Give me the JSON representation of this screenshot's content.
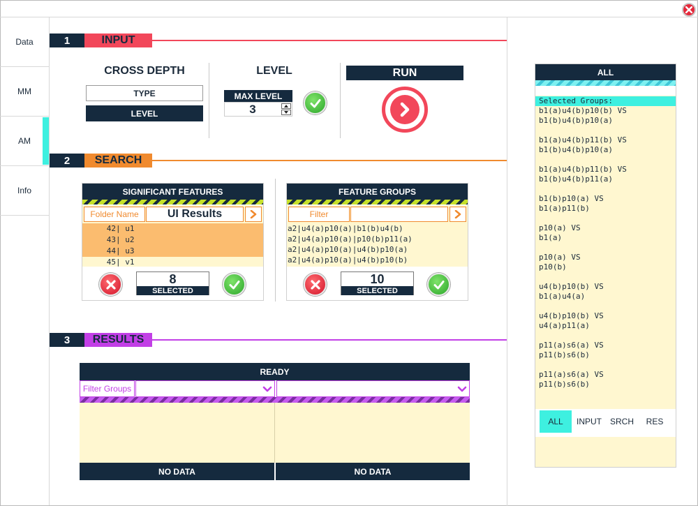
{
  "colors": {
    "navy": "#152a3e",
    "input_accent": "#f2475a",
    "search_accent": "#f08a2e",
    "results_accent": "#c23fe6",
    "cream": "#fff7d0",
    "cyan": "#3ef0e0",
    "green_ok": "#3fc43b",
    "red_cancel": "#e5283a"
  },
  "icons": {
    "close": "close-icon",
    "check": "check-icon",
    "cancel": "x-icon",
    "run": "chevron-right-icon",
    "arrow": "chevron-right-icon",
    "dropdown": "chevron-down-icon"
  },
  "sidebar": {
    "tabs": [
      "Data",
      "MM",
      "AM",
      "Info"
    ],
    "active": "AM"
  },
  "input": {
    "num": "1",
    "title": "INPUT",
    "cross_depth_title": "CROSS DEPTH",
    "type_label": "TYPE",
    "level_option_label": "LEVEL",
    "level_title": "LEVEL",
    "max_level_label": "MAX LEVEL",
    "max_level_value": "3",
    "run_label": "RUN"
  },
  "search": {
    "num": "2",
    "title": "SEARCH",
    "sig": {
      "title": "SIGNIFICANT FEATURES",
      "folder_label": "Folder Name",
      "folder_value": "UI Results",
      "rows": [
        {
          "num": "42",
          "name": "u1"
        },
        {
          "num": "43",
          "name": "u2"
        },
        {
          "num": "44",
          "name": "u3"
        },
        {
          "num": "45",
          "name": "v1"
        }
      ],
      "count": "8",
      "selected_label": "SELECTED"
    },
    "groups": {
      "title": "FEATURE GROUPS",
      "filter_placeholder": "Filter",
      "rows": [
        "a2|u4(a)p10(a)|b1(b)u4(b)",
        "a2|u4(a)p10(a)|p10(b)p11(a)",
        "a2|u4(a)p10(a)|u4(b)p10(a)",
        "a2|u4(a)p10(a)|u4(b)p10(b)"
      ],
      "count": "10",
      "selected_label": "SELECTED"
    }
  },
  "results": {
    "num": "3",
    "title": "RESULTS",
    "status": "READY",
    "filter_label": "Filter Groups",
    "no_data_left": "NO DATA",
    "no_data_right": "NO DATA"
  },
  "right_panel": {
    "title": "ALL",
    "selected_header": "Selected Groups:",
    "pairs": [
      [
        "b1(a)u4(b)p10(b) VS",
        "b1(b)u4(b)p10(a)"
      ],
      [
        "b1(a)u4(b)p11(b) VS",
        "b1(b)u4(b)p10(a)"
      ],
      [
        "b1(a)u4(b)p11(b) VS",
        "b1(b)u4(b)p11(a)"
      ],
      [
        "b1(b)p10(a) VS",
        "b1(a)p11(b)"
      ],
      [
        "p10(a) VS",
        "b1(a)"
      ],
      [
        "p10(a) VS",
        "p10(b)"
      ],
      [
        "u4(b)p10(b) VS",
        "b1(a)u4(a)"
      ],
      [
        "u4(b)p10(b) VS",
        "u4(a)p11(a)"
      ],
      [
        "p11(a)s6(a) VS",
        "p11(b)s6(b)"
      ],
      [
        "p11(a)s6(a) VS",
        "p11(b)s6(b)"
      ]
    ],
    "tabs": [
      "ALL",
      "INPUT",
      "SRCH",
      "RES"
    ],
    "active_tab": "ALL"
  }
}
